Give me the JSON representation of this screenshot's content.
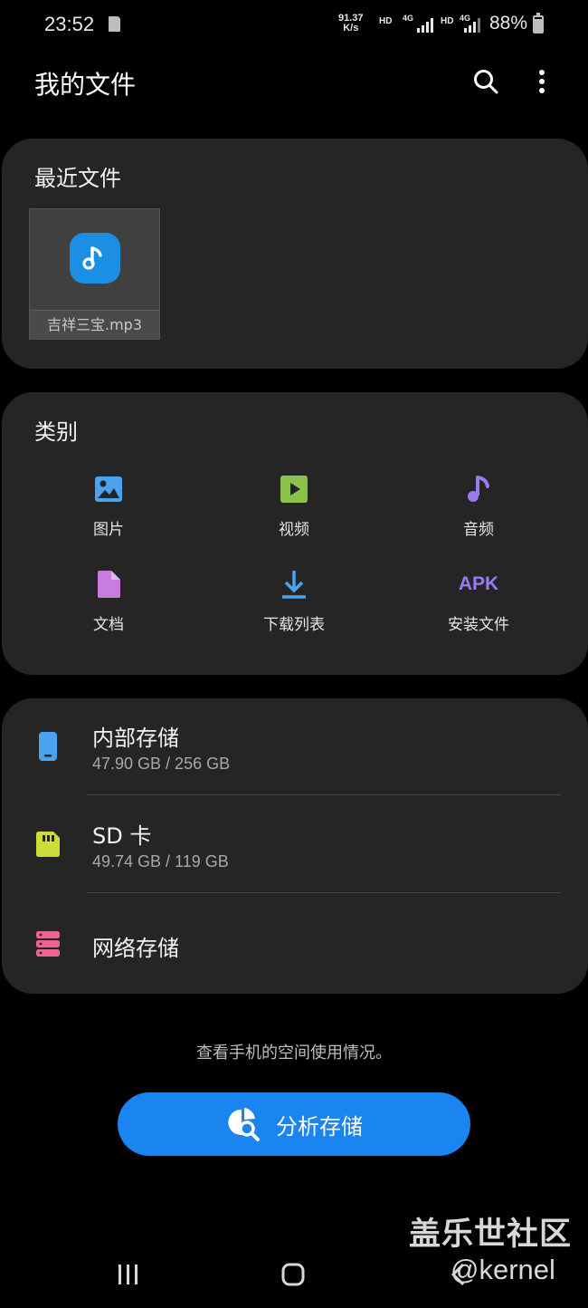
{
  "status_bar": {
    "time": "23:52",
    "speed_value": "91.37",
    "speed_unit": "K/s",
    "net1": "HD",
    "net1_gen": "4G",
    "net2": "HD",
    "net2_gen": "4G",
    "battery_text": "88%",
    "battery_level": 0.88
  },
  "app_bar": {
    "title": "我的文件",
    "search_icon": "search-icon",
    "more_icon": "more-vert-icon"
  },
  "recent": {
    "title": "最近文件",
    "files": [
      {
        "name": "吉祥三宝.mp3",
        "icon": "music-note-icon"
      }
    ]
  },
  "categories": {
    "title": "类别",
    "items": [
      {
        "label": "图片",
        "icon": "image-icon",
        "color": "#4aa3f0"
      },
      {
        "label": "视频",
        "icon": "video-icon",
        "color": "#8bc34a"
      },
      {
        "label": "音频",
        "icon": "audio-icon",
        "color": "#9a7af0"
      },
      {
        "label": "文档",
        "icon": "document-icon",
        "color": "#c77dde"
      },
      {
        "label": "下载列表",
        "icon": "download-icon",
        "color": "#4aa3f0"
      },
      {
        "label": "安装文件",
        "icon": "apk-icon",
        "icon_text": "APK",
        "color": "#9a7af0"
      }
    ]
  },
  "storage": {
    "items": [
      {
        "name": "内部存储",
        "size": "47.90 GB / 256 GB",
        "icon": "phone-storage-icon",
        "color": "#4aa3f0"
      },
      {
        "name": "SD 卡",
        "size": "49.74 GB / 119 GB",
        "icon": "sd-card-icon",
        "color": "#cddc39"
      },
      {
        "name": "网络存储",
        "size": "",
        "icon": "network-storage-icon",
        "color": "#f06292"
      }
    ]
  },
  "analyze": {
    "hint": "查看手机的空间使用情况。",
    "button_label": "分析存储",
    "icon": "storage-analysis-icon",
    "color": "#1a84f0"
  },
  "watermark": {
    "line1": "盖乐世社区",
    "line2": "@kernel"
  },
  "nav_bar": {
    "recents_icon": "recents-icon",
    "home_icon": "home-icon",
    "back_icon": "back-icon"
  }
}
